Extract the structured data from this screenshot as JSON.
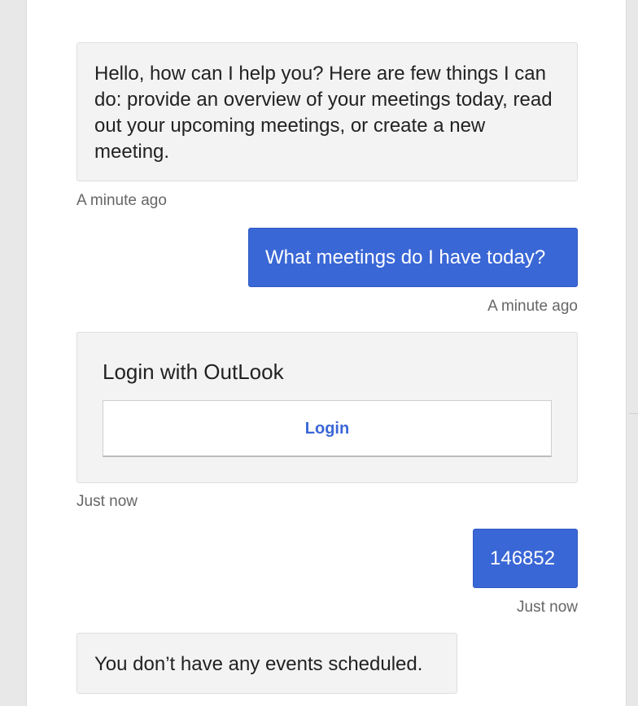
{
  "conversation": {
    "messages": [
      {
        "sender": "bot",
        "text": "Hello, how can I help you? Here are few things I can do: provide an overview of your meetings today, read out your upcoming meetings, or create a new meeting.",
        "timestamp": "A minute ago"
      },
      {
        "sender": "user",
        "text": "What meetings do I have today?",
        "timestamp": "A minute ago"
      },
      {
        "sender": "bot",
        "card": {
          "title": "Login with OutLook",
          "button_label": "Login"
        },
        "timestamp": "Just now"
      },
      {
        "sender": "user",
        "text": "146852",
        "timestamp": "Just now"
      },
      {
        "sender": "bot",
        "text": "You don’t have any events scheduled."
      }
    ]
  },
  "colors": {
    "user_bubble": "#3a67d6",
    "bot_bubble": "#f3f3f3",
    "link_text": "#3a67d6"
  }
}
